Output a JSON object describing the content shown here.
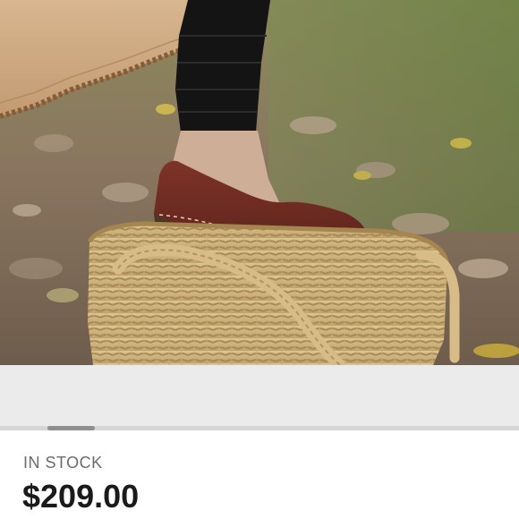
{
  "product": {
    "image_alt": "Brown leather clog on a woven straw basket",
    "stock_status": "IN STOCK",
    "price": "$209.00"
  },
  "gallery": {
    "scroll_position_fraction": 0.09
  },
  "colors": {
    "price_text": "#1a1a1a",
    "stock_text": "#6b6b6b",
    "clog_leather": "#6b2a22"
  }
}
